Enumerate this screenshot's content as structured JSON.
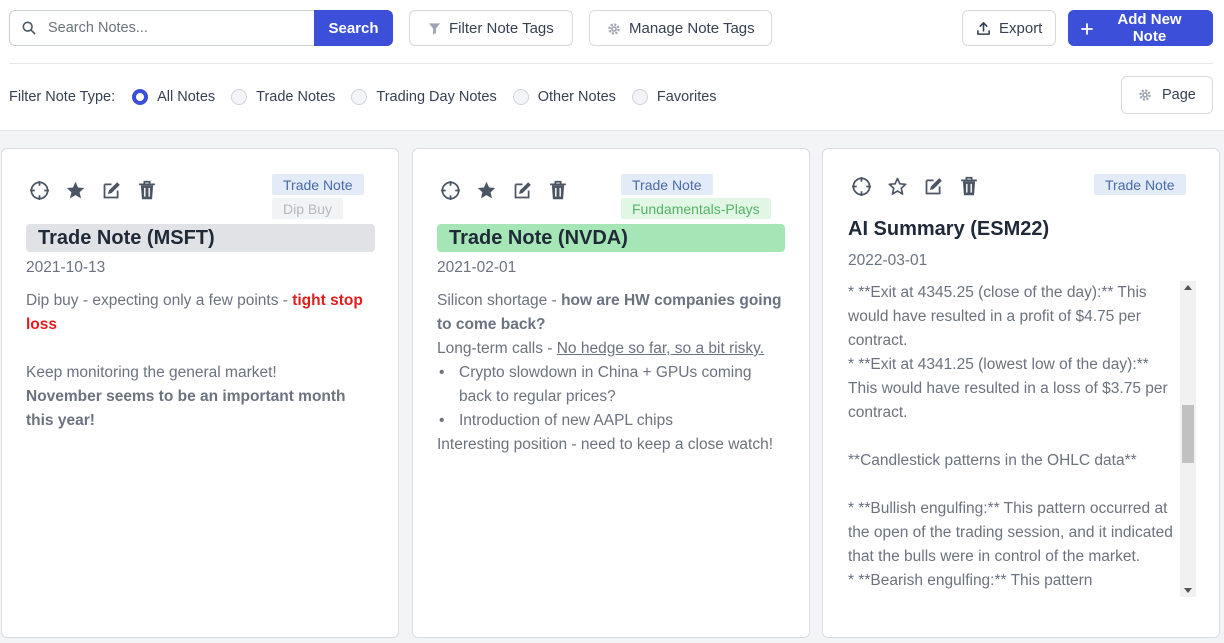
{
  "toolbar": {
    "search_placeholder": "Search Notes...",
    "search_button": "Search",
    "filter_tags": "Filter Note Tags",
    "manage_tags": "Manage Note Tags",
    "export": "Export",
    "add_note": "Add New Note"
  },
  "filter": {
    "label": "Filter Note Type:",
    "options": [
      {
        "label": "All Notes",
        "checked": true
      },
      {
        "label": "Trade Notes",
        "checked": false
      },
      {
        "label": "Trading Day Notes",
        "checked": false
      },
      {
        "label": "Other Notes",
        "checked": false
      },
      {
        "label": "Favorites",
        "checked": false
      }
    ],
    "page_button": "Page"
  },
  "cards": [
    {
      "tags": [
        "Trade Note",
        "Dip Buy"
      ],
      "title": "Trade Note (MSFT)",
      "title_bg": "#e0e2e5",
      "date": "2021-10-13",
      "favorited": true,
      "body": {
        "p1": "Dip buy - expecting only a few points - ",
        "p1_red": "tight stop loss",
        "p2": "Keep monitoring the general market!",
        "p3_bold": "November seems to be an important month this year!"
      }
    },
    {
      "tags": [
        "Trade Note",
        "Fundamentals-Plays"
      ],
      "title": "Trade Note (NVDA)",
      "title_bg": "#a6e6b6",
      "date": "2021-02-01",
      "favorited": true,
      "body": {
        "p1": "Silicon shortage - ",
        "p1_bold": "how are HW companies going to come back?",
        "p2": "Long-term calls - ",
        "p2_underline": "No hedge so far, so a bit risky.",
        "bullet1": "Crypto slowdown in China + GPUs coming back to regular prices?",
        "bullet2": "Introduction of new AAPL chips",
        "p3": "Interesting position - need to keep a close watch!"
      }
    },
    {
      "tags": [
        "Trade Note"
      ],
      "title": "AI Summary (ESM22)",
      "date": "2022-03-01",
      "favorited": false,
      "body_text": "* **Exit at 4345.25 (close of the day):** This would have resulted in a profit of $4.75 per contract.\n* **Exit at 4341.25 (lowest low of the day):** This would have resulted in a loss of $3.75 per contract.\n\n**Candlestick patterns in the OHLC data**\n\n* **Bullish engulfing:** This pattern occurred at the open of the trading session, and it indicated that the bulls were in control of the market.\n* **Bearish engulfing:** This pattern"
    }
  ],
  "colors": {
    "primary": "#3b4fd8",
    "tag_blue_bg": "#e3eaf8",
    "tag_green_bg": "#e2f6e6",
    "red_text": "#e11d1d"
  }
}
